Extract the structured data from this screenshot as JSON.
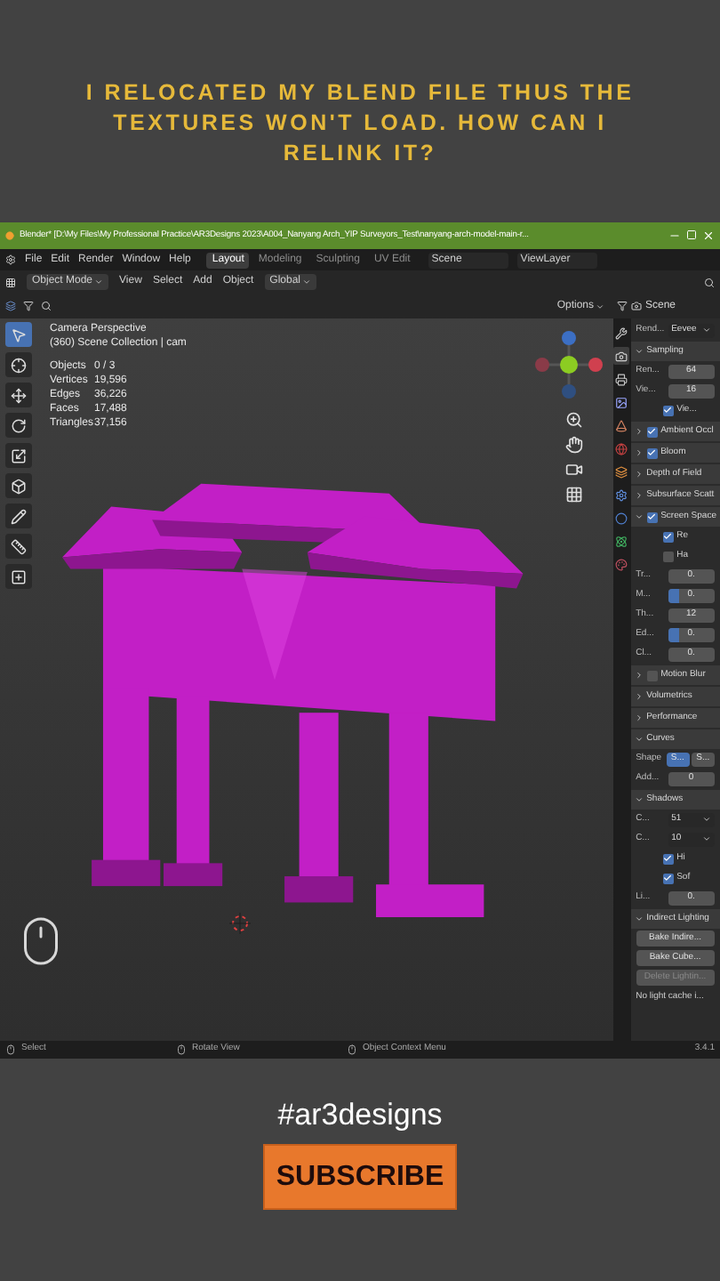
{
  "caption": "I RELOCATED MY BLEND FILE THUS THE TEXTURES WON'T LOAD. HOW CAN I RELINK IT?",
  "window": {
    "title": "Blender* [D:\\My Files\\My Professional Practice\\AR3Designs 2023\\A004_Nanyang Arch_YIP Surveyors_Test\\nanyang-arch-model-main-r..."
  },
  "menu": [
    "File",
    "Edit",
    "Render",
    "Window",
    "Help"
  ],
  "workspaces": [
    {
      "label": "Layout",
      "selected": true
    },
    {
      "label": "Modeling",
      "selected": false
    },
    {
      "label": "Sculpting",
      "selected": false
    },
    {
      "label": "UV Edit",
      "selected": false
    }
  ],
  "scene": "Scene",
  "view_layer": "ViewLayer",
  "header": {
    "mode": "Object Mode",
    "menus": [
      "View",
      "Select",
      "Add",
      "Object"
    ],
    "orientation": "Global"
  },
  "viewport": {
    "options": "Options",
    "overlay_lines": [
      "Camera Perspective",
      "(360) Scene Collection | cam"
    ],
    "stats": [
      {
        "label": "Objects",
        "value": "0 / 3"
      },
      {
        "label": "Vertices",
        "value": "19,596"
      },
      {
        "label": "Edges",
        "value": "36,226"
      },
      {
        "label": "Faces",
        "value": "17,488"
      },
      {
        "label": "Triangles",
        "value": "37,156"
      }
    ]
  },
  "toolbar": [
    {
      "selected": true
    },
    {
      "selected": false
    },
    {
      "selected": false
    },
    {
      "selected": false
    },
    {
      "selected": false
    },
    {
      "selected": false
    },
    {
      "selected": false
    },
    {
      "selected": false
    },
    {
      "selected": false
    }
  ],
  "properties": {
    "title": "Scene",
    "tabs": [
      {
        "selected": false
      },
      {
        "selected": true
      },
      {
        "selected": false
      },
      {
        "selected": false
      },
      {
        "selected": false
      },
      {
        "selected": false
      },
      {
        "selected": false
      },
      {
        "selected": false
      },
      {
        "selected": false
      },
      {
        "selected": false
      },
      {
        "selected": false
      }
    ],
    "rows": [
      {
        "kind": "dropdown",
        "label": "Rend...",
        "value": "Eevee"
      },
      {
        "kind": "section",
        "label": "Sampling",
        "expanded": true
      },
      {
        "kind": "field",
        "label": "Ren...",
        "value": "64"
      },
      {
        "kind": "field",
        "label": "Vie...",
        "value": "16"
      },
      {
        "kind": "checkbox",
        "label": "Vie...",
        "checked": true
      },
      {
        "kind": "section",
        "label": "Ambient Occl",
        "expanded": false,
        "checked": true
      },
      {
        "kind": "section",
        "label": "Bloom",
        "expanded": false,
        "checked": true
      },
      {
        "kind": "section",
        "label": "Depth of Field",
        "expanded": false
      },
      {
        "kind": "section",
        "label": "Subsurface Scatt",
        "expanded": false
      },
      {
        "kind": "section",
        "label": "Screen Space",
        "expanded": true,
        "checked": true
      },
      {
        "kind": "checkbox",
        "label": "Re",
        "checked": true
      },
      {
        "kind": "checkbox",
        "label": "Ha",
        "checked": false
      },
      {
        "kind": "field",
        "label": "Tr...",
        "value": "0."
      },
      {
        "kind": "field",
        "label": "M...",
        "value": "0.",
        "level": 0.25
      },
      {
        "kind": "field",
        "label": "Th...",
        "value": "12"
      },
      {
        "kind": "field",
        "label": "Ed...",
        "value": "0.",
        "level": 0.25
      },
      {
        "kind": "field",
        "label": "Cl...",
        "value": "0."
      },
      {
        "kind": "section",
        "label": "Motion Blur",
        "expanded": false,
        "checked": false
      },
      {
        "kind": "section",
        "label": "Volumetrics",
        "expanded": false
      },
      {
        "kind": "section",
        "label": "Performance",
        "expanded": false
      },
      {
        "kind": "section",
        "label": "Curves",
        "expanded": true
      },
      {
        "kind": "options",
        "label": "Shape",
        "options": [
          {
            "label": "S...",
            "selected": true
          },
          {
            "label": "S...",
            "selected": false
          }
        ]
      },
      {
        "kind": "field",
        "label": "Add...",
        "value": "0"
      },
      {
        "kind": "section",
        "label": "Shadows",
        "expanded": true
      },
      {
        "kind": "dropdown",
        "label": "C...",
        "value": "51"
      },
      {
        "kind": "dropdown",
        "label": "C...",
        "value": "10"
      },
      {
        "kind": "checkbox",
        "label": "Hi",
        "checked": true
      },
      {
        "kind": "checkbox",
        "label": "Sof",
        "checked": true
      },
      {
        "kind": "field",
        "label": "Li...",
        "value": "0."
      },
      {
        "kind": "section",
        "label": "Indirect Lighting",
        "expanded": true
      },
      {
        "kind": "button",
        "label": "Bake Indire...",
        "disabled": false
      },
      {
        "kind": "button",
        "label": "Bake Cube...",
        "disabled": false
      },
      {
        "kind": "button",
        "label": "Delete Lightin...",
        "disabled": true
      },
      {
        "kind": "note",
        "label": "No light cache i..."
      }
    ]
  },
  "status_bar": {
    "items": [
      "Select",
      "Rotate View",
      "Object Context Menu"
    ],
    "version": "3.4.1"
  },
  "hashtag": "#ar3designs",
  "subscribe": "SUBSCRIBE"
}
